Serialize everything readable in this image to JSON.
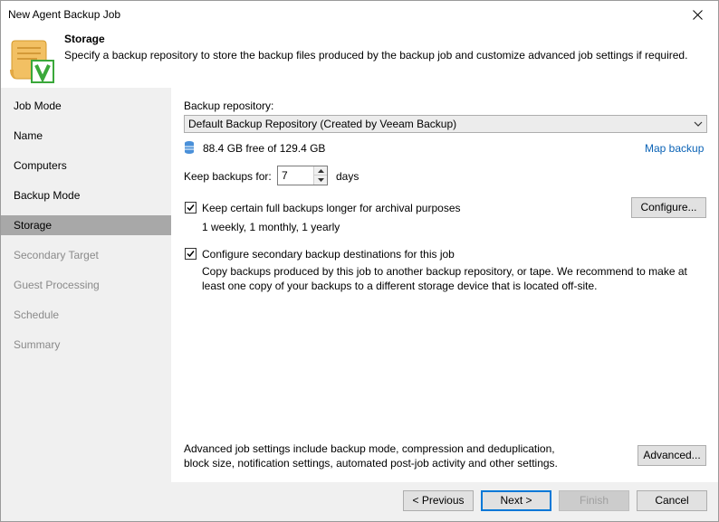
{
  "window": {
    "title": "New Agent Backup Job"
  },
  "header": {
    "title": "Storage",
    "description": "Specify a backup repository to store the backup files produced by the backup job and customize advanced job settings if required."
  },
  "sidebar": {
    "items": [
      {
        "label": "Job Mode",
        "state": "normal"
      },
      {
        "label": "Name",
        "state": "normal"
      },
      {
        "label": "Computers",
        "state": "normal"
      },
      {
        "label": "Backup Mode",
        "state": "normal"
      },
      {
        "label": "Storage",
        "state": "active"
      },
      {
        "label": "Secondary Target",
        "state": "disabled"
      },
      {
        "label": "Guest Processing",
        "state": "disabled"
      },
      {
        "label": "Schedule",
        "state": "disabled"
      },
      {
        "label": "Summary",
        "state": "disabled"
      }
    ]
  },
  "main": {
    "repository_label": "Backup repository:",
    "repository_value": "Default Backup Repository (Created by Veeam Backup)",
    "free_space": "88.4 GB free of 129.4 GB",
    "map_backup_link": "Map backup",
    "keep_label": "Keep backups for:",
    "keep_value": "7",
    "keep_unit": "days",
    "archival_checkbox_label": "Keep certain full backups longer for archival purposes",
    "archival_checked": true,
    "archival_summary": "1 weekly, 1 monthly, 1 yearly",
    "configure_button": "Configure...",
    "secondary_checkbox_label": "Configure secondary backup destinations for this job",
    "secondary_checked": true,
    "secondary_desc_line1": "Copy backups produced by this job to another backup repository, or tape. We recommend to make at",
    "secondary_desc_line2": "least one copy of your backups to a different storage device that is located off-site.",
    "advanced_desc_line1": "Advanced job settings include backup mode, compression and deduplication,",
    "advanced_desc_line2": "block size, notification settings, automated post-job activity and other settings.",
    "advanced_button": "Advanced..."
  },
  "footer": {
    "previous_button": "< Previous",
    "next_button": "Next >",
    "finish_button": "Finish",
    "cancel_button": "Cancel"
  },
  "colors": {
    "link": "#0b63b6",
    "active_nav": "#a8a8a8",
    "sidebar_bg": "#f0f0f0",
    "logo_green": "#3aa83a"
  },
  "icons": {
    "header": "veeam-scroll-icon",
    "disk": "database-icon",
    "close": "close-icon"
  }
}
